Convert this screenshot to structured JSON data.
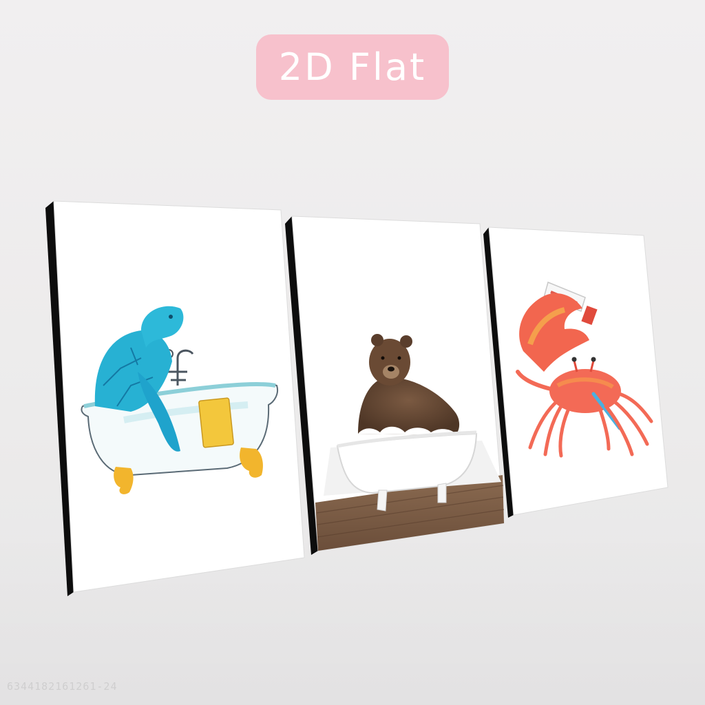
{
  "badge": {
    "label": "2D Flat"
  },
  "palette": {
    "badge_bg": "#f7c1cc",
    "frame": "#111111",
    "turtle": "#28b6d6",
    "bear": "#6a4a34",
    "crab": "#f2624c"
  },
  "canvases": [
    {
      "subject": "turtle-in-bathtub"
    },
    {
      "subject": "bear-in-bathtub"
    },
    {
      "subject": "crab-brushing-teeth"
    }
  ],
  "watermark": "6344182161261-24"
}
